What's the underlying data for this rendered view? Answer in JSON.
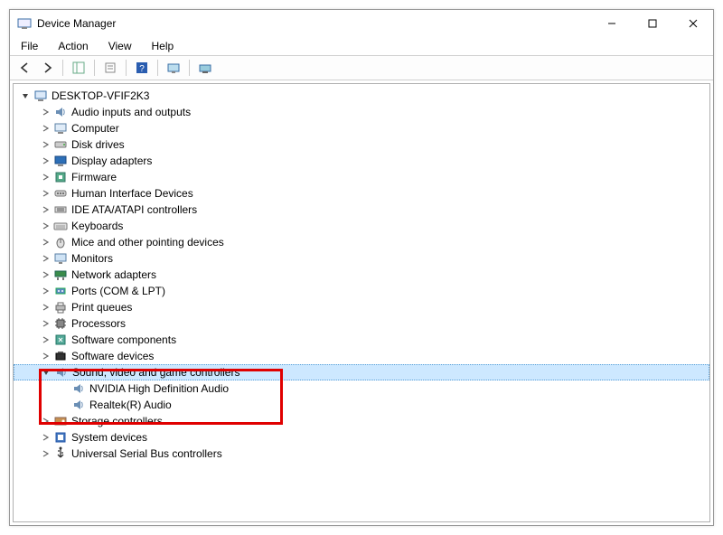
{
  "window": {
    "title": "Device Manager"
  },
  "menu": {
    "file": "File",
    "action": "Action",
    "view": "View",
    "help": "Help"
  },
  "tree": {
    "root": "DESKTOP-VFIF2K3",
    "categories": [
      {
        "label": "Audio inputs and outputs",
        "icon": "speaker"
      },
      {
        "label": "Computer",
        "icon": "computer"
      },
      {
        "label": "Disk drives",
        "icon": "disk"
      },
      {
        "label": "Display adapters",
        "icon": "display"
      },
      {
        "label": "Firmware",
        "icon": "firmware"
      },
      {
        "label": "Human Interface Devices",
        "icon": "hid"
      },
      {
        "label": "IDE ATA/ATAPI controllers",
        "icon": "ide"
      },
      {
        "label": "Keyboards",
        "icon": "keyboard"
      },
      {
        "label": "Mice and other pointing devices",
        "icon": "mouse"
      },
      {
        "label": "Monitors",
        "icon": "monitor"
      },
      {
        "label": "Network adapters",
        "icon": "network"
      },
      {
        "label": "Ports (COM & LPT)",
        "icon": "port"
      },
      {
        "label": "Print queues",
        "icon": "printer"
      },
      {
        "label": "Processors",
        "icon": "cpu"
      },
      {
        "label": "Software components",
        "icon": "swcomp"
      },
      {
        "label": "Software devices",
        "icon": "swdev"
      },
      {
        "label": "Sound, video and game controllers",
        "icon": "speaker",
        "expanded": true,
        "selected": true,
        "children": [
          {
            "label": "NVIDIA High Definition Audio",
            "icon": "speaker"
          },
          {
            "label": "Realtek(R) Audio",
            "icon": "speaker"
          }
        ]
      },
      {
        "label": "Storage controllers",
        "icon": "storage"
      },
      {
        "label": "System devices",
        "icon": "system"
      },
      {
        "label": "Universal Serial Bus controllers",
        "icon": "usb"
      }
    ]
  }
}
